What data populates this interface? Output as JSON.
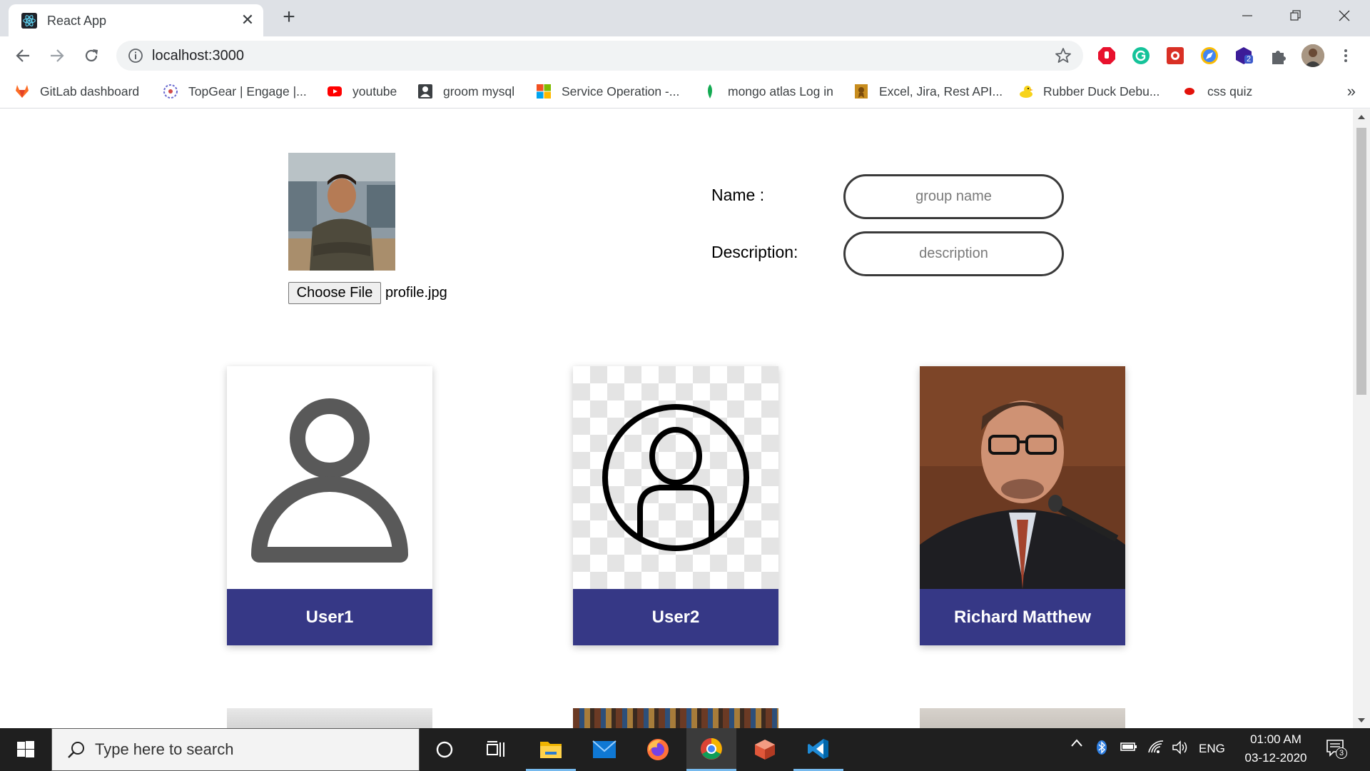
{
  "browser": {
    "tab_title": "React App",
    "url": "localhost:3000",
    "bookmarks": [
      {
        "label": "GitLab dashboard",
        "icon": "gitlab-icon"
      },
      {
        "label": "TopGear | Engage |...",
        "icon": "topgear-icon"
      },
      {
        "label": "youtube",
        "icon": "youtube-icon"
      },
      {
        "label": "groom mysql",
        "icon": "user-square-icon"
      },
      {
        "label": "Service Operation -...",
        "icon": "microsoft-icon"
      },
      {
        "label": "mongo atlas Log in",
        "icon": "mongodb-leaf-icon"
      },
      {
        "label": "Excel, Jira, Rest API...",
        "icon": "certificate-icon"
      },
      {
        "label": "Rubber Duck Debu...",
        "icon": "duck-icon"
      },
      {
        "label": "css quiz",
        "icon": "red-dot-icon"
      }
    ],
    "extension_badge": "2"
  },
  "page": {
    "file_input": {
      "button_label": "Choose File",
      "file_name": "profile.jpg"
    },
    "form": {
      "name_label": "Name :",
      "name_placeholder": "group name",
      "description_label": "Description:",
      "description_placeholder": "description"
    },
    "users": [
      {
        "name": "User1",
        "image": "person-outline-icon"
      },
      {
        "name": "User2",
        "image": "person-circle-icon"
      },
      {
        "name": "Richard Matthew",
        "image": "photo"
      }
    ]
  },
  "taskbar": {
    "search_placeholder": "Type here to search",
    "language": "ENG",
    "time": "01:00 AM",
    "date": "03-12-2020",
    "notification_count": "3"
  },
  "colors": {
    "card_label_bg": "#363886",
    "taskbar_bg": "#1f1f1f",
    "chrome_tabstrip": "#dee1e6"
  }
}
